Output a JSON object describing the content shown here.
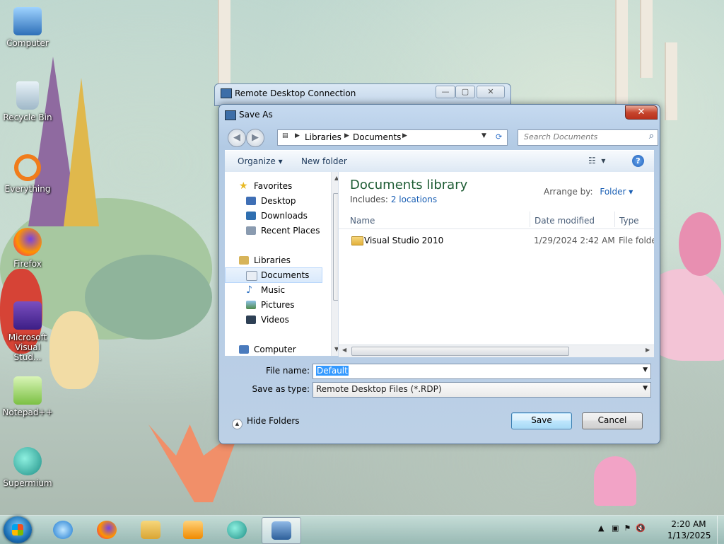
{
  "desktop": {
    "icons": [
      {
        "label": "Computer"
      },
      {
        "label": "Recycle Bin"
      },
      {
        "label": "Everything"
      },
      {
        "label": "Firefox"
      },
      {
        "label": "Microsoft Visual Stud..."
      },
      {
        "label": "Notepad++"
      },
      {
        "label": "Supermium"
      }
    ]
  },
  "rdc_window": {
    "title": "Remote Desktop Connection",
    "min": "—",
    "max": "▢",
    "close": "✕"
  },
  "dialog": {
    "title": "Save As",
    "close": "✕",
    "address": {
      "segments": [
        "Libraries",
        "Documents"
      ]
    },
    "search_placeholder": "Search Documents",
    "toolbar": {
      "organize": "Organize ▾",
      "new_folder": "New folder",
      "help": "?"
    },
    "nav": {
      "favorites": "Favorites",
      "desktop": "Desktop",
      "downloads": "Downloads",
      "recent": "Recent Places",
      "libraries": "Libraries",
      "documents": "Documents",
      "music": "Music",
      "pictures": "Pictures",
      "videos": "Videos",
      "computer": "Computer"
    },
    "library": {
      "title": "Documents library",
      "includes_label": "Includes:",
      "includes_link": "2 locations",
      "arrange_label": "Arrange by:",
      "arrange_value": "Folder ▾"
    },
    "columns": {
      "name": "Name",
      "date": "Date modified",
      "type": "Type"
    },
    "files": [
      {
        "name": "Visual Studio 2010",
        "date": "1/29/2024 2:42 AM",
        "type": "File folder"
      }
    ],
    "form": {
      "file_name_label": "File name:",
      "file_name_value": "Default",
      "save_type_label": "Save as type:",
      "save_type_value": "Remote Desktop Files (*.RDP)"
    },
    "hide_folders": "Hide Folders",
    "save": "Save",
    "cancel": "Cancel"
  },
  "taskbar": {
    "time": "2:20 AM",
    "date": "1/13/2025"
  }
}
